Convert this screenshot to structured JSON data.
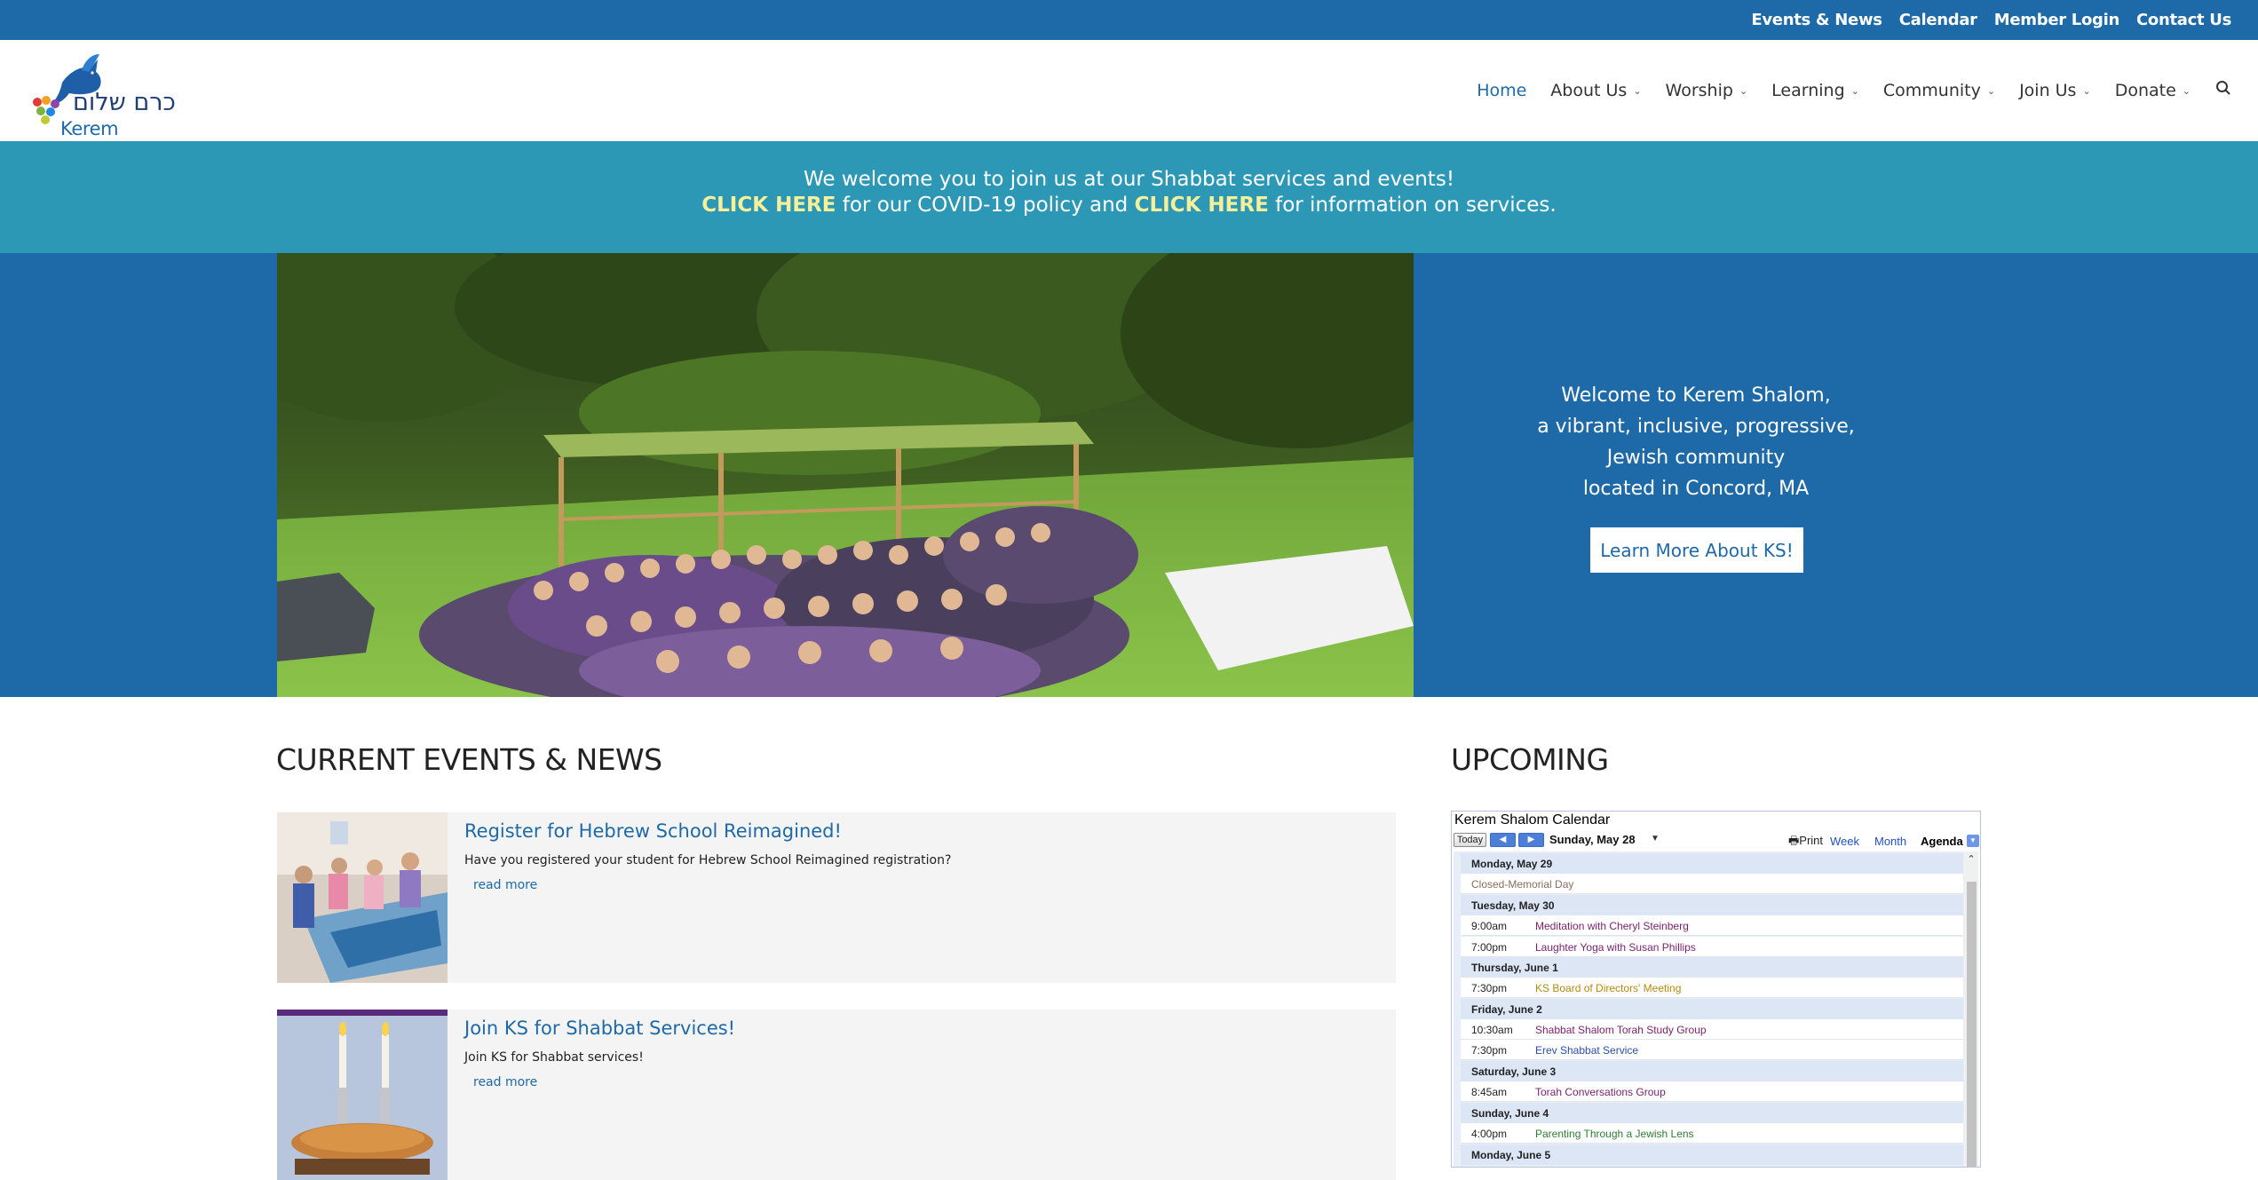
{
  "topbar": {
    "links": [
      "Events & News",
      "Calendar",
      "Member Login",
      "Contact Us"
    ]
  },
  "logo": {
    "hebrew": "כרם שלום",
    "english": "Kerem Shalom"
  },
  "nav": {
    "items": [
      {
        "label": "Home",
        "active": true,
        "dropdown": false
      },
      {
        "label": "About Us",
        "active": false,
        "dropdown": true
      },
      {
        "label": "Worship",
        "active": false,
        "dropdown": true
      },
      {
        "label": "Learning",
        "active": false,
        "dropdown": true
      },
      {
        "label": "Community",
        "active": false,
        "dropdown": true
      },
      {
        "label": "Join Us",
        "active": false,
        "dropdown": true
      },
      {
        "label": "Donate",
        "active": false,
        "dropdown": true
      }
    ],
    "search_icon": "search-icon"
  },
  "banner": {
    "line1": "We welcome you to join us at our Shabbat services and events!",
    "cta1": "CLICK HERE",
    "mid": " for our COVID-19 policy and ",
    "cta2": "CLICK HERE",
    "end": " for information on services."
  },
  "hero": {
    "lines": [
      "Welcome to Kerem Shalom,",
      "a vibrant, inclusive, progressive,",
      "Jewish community",
      "located in Concord, MA"
    ],
    "button": "Learn More About KS!"
  },
  "news": {
    "title": "CURRENT EVENTS & NEWS",
    "items": [
      {
        "title": "Register for Hebrew School Reimagined!",
        "excerpt": "Have you registered your student for Hebrew School Reimagined registration?",
        "more": "read more"
      },
      {
        "title": "Join KS for Shabbat Services!",
        "excerpt": "Join KS for Shabbat services!",
        "more": "read more"
      }
    ]
  },
  "upcoming": {
    "title": "UPCOMING",
    "calendar": {
      "title": "Kerem Shalom Calendar",
      "today": "Today",
      "date": "Sunday, May 28",
      "print": "Print",
      "views": [
        "Week",
        "Month",
        "Agenda"
      ],
      "selected_view": "Agenda",
      "rows": [
        {
          "type": "day",
          "text": "Monday, May 29"
        },
        {
          "type": "allday",
          "text": "Closed-Memorial Day",
          "color": "#8a6d5c"
        },
        {
          "type": "day",
          "text": "Tuesday, May 30"
        },
        {
          "type": "event",
          "time": "9:00am",
          "name": "Meditation with Cheryl Steinberg",
          "color": "#7a1f6e"
        },
        {
          "type": "event",
          "time": "7:00pm",
          "name": "Laughter Yoga with Susan Phillips",
          "color": "#7a1f6e"
        },
        {
          "type": "day",
          "text": "Thursday, June 1"
        },
        {
          "type": "event",
          "time": "7:30pm",
          "name": "KS Board of Directors' Meeting",
          "color": "#b5880e"
        },
        {
          "type": "day",
          "text": "Friday, June 2"
        },
        {
          "type": "event",
          "time": "10:30am",
          "name": "Shabbat Shalom Torah Study Group",
          "color": "#7a1f6e"
        },
        {
          "type": "event",
          "time": "7:30pm",
          "name": "Erev Shabbat Service",
          "color": "#2a4fa8"
        },
        {
          "type": "day",
          "text": "Saturday, June 3"
        },
        {
          "type": "event",
          "time": "8:45am",
          "name": "Torah Conversations Group",
          "color": "#7a1f6e"
        },
        {
          "type": "day",
          "text": "Sunday, June 4"
        },
        {
          "type": "event",
          "time": "4:00pm",
          "name": "Parenting Through a Jewish Lens",
          "color": "#2e7d32"
        },
        {
          "type": "day",
          "text": "Monday, June 5"
        }
      ]
    }
  },
  "colors": {
    "topbar": "#1e69a8",
    "banner": "#2d98b6",
    "cta": "#f7f09a",
    "link": "#1e69a8"
  }
}
